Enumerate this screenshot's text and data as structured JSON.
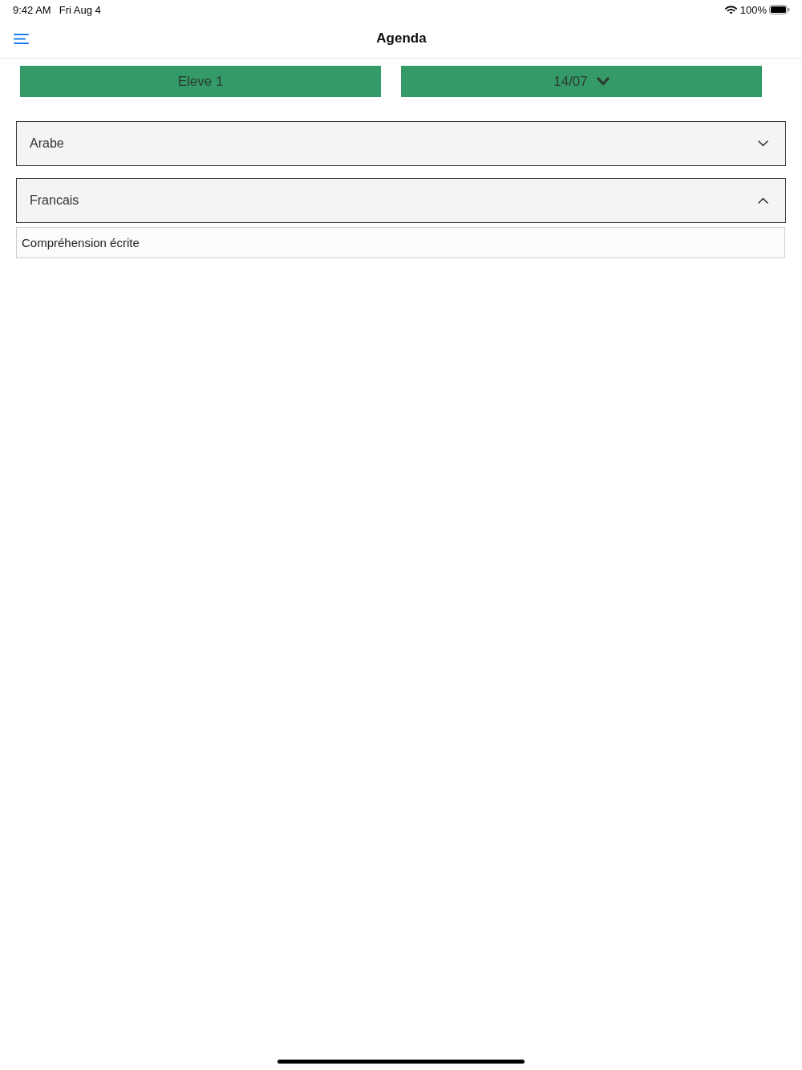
{
  "status_bar": {
    "time": "9:42 AM",
    "date": "Fri Aug 4",
    "battery": "100%"
  },
  "nav_bar": {
    "title": "Agenda"
  },
  "selectors": [
    {
      "label": "Eleve 1",
      "dropdown": false
    },
    {
      "label": "14/07",
      "dropdown": true
    }
  ],
  "subjects": [
    {
      "name": "Arabe",
      "expanded": false
    },
    {
      "name": "Francais",
      "expanded": true,
      "children": [
        {
          "label": "Compréhension écrite"
        }
      ]
    }
  ]
}
